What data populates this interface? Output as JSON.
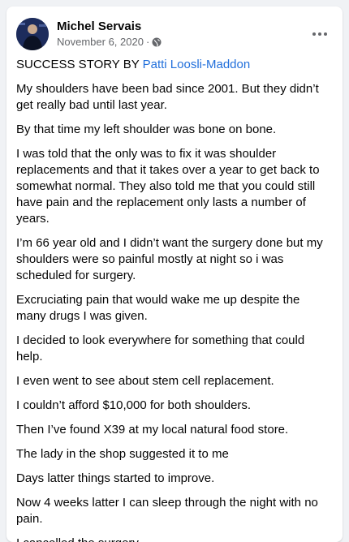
{
  "post": {
    "author": "Michel Servais",
    "date": "November 6, 2020",
    "separator": "·",
    "audience_icon": "globe-icon",
    "more_icon": "more-options-icon",
    "headline_prefix": "SUCCESS STORY BY ",
    "headline_mention": "Patti Loosli-Maddon",
    "paragraphs": [
      "My shoulders have been bad since 2001. But they didn’t get really bad until last year.",
      "By that time my left shoulder was bone on bone.",
      "I was told that the only was to fix it was shoulder replacements and that it takes over a year to get back to somewhat normal. They also told me that you could still have pain and the replacement only lasts a number of years.",
      "I’m 66 year old and I didn’t want the surgery done but my shoulders were so painful mostly at night so i was scheduled for surgery.",
      "Excruciating pain that would wake me up despite the many drugs I was given.",
      "I decided to look everywhere for something that could help.",
      "I even went to see about stem cell replacement.",
      "I couldn’t afford $10,000 for both shoulders.",
      "Then I’ve found X39 at my local natural food store.",
      "The lady in the shop suggested it to me",
      "Days latter things started to improve.",
      "Now 4 weeks latter I can sleep through the night with no pain.",
      "I cancelled the surgery."
    ]
  },
  "colors": {
    "mention": "#216fdb",
    "text": "#050505",
    "secondary": "#65676b"
  }
}
